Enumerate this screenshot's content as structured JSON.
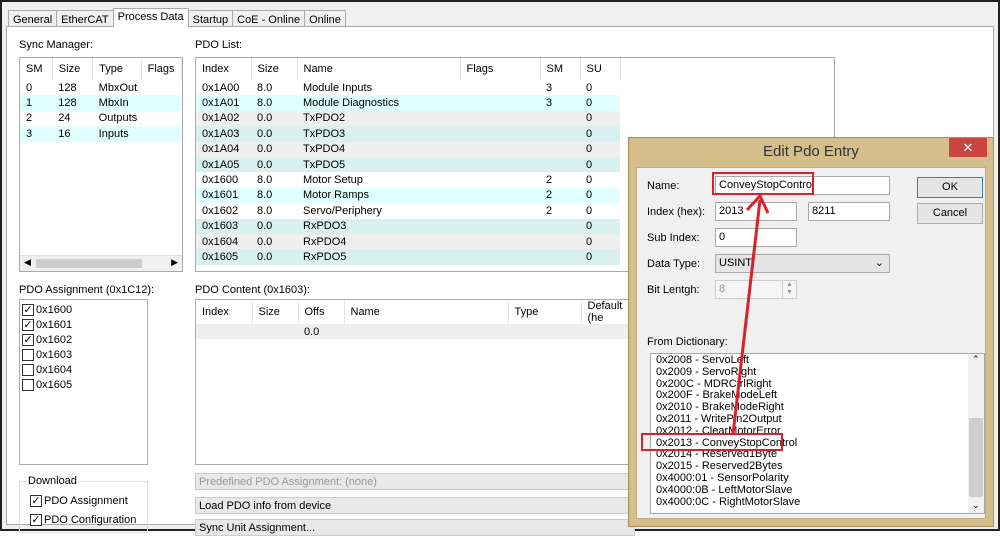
{
  "tabs": [
    "General",
    "EtherCAT",
    "Process Data",
    "Startup",
    "CoE - Online",
    "Online"
  ],
  "sync_manager": {
    "label": "Sync Manager:",
    "columns": [
      "SM",
      "Size",
      "Type",
      "Flags"
    ],
    "rows": [
      [
        "0",
        "128",
        "MbxOut",
        ""
      ],
      [
        "1",
        "128",
        "MbxIn",
        ""
      ],
      [
        "2",
        "24",
        "Outputs",
        ""
      ],
      [
        "3",
        "16",
        "Inputs",
        ""
      ]
    ]
  },
  "pdo_list": {
    "label": "PDO List:",
    "columns": [
      "Index",
      "Size",
      "Name",
      "Flags",
      "SM",
      "SU"
    ],
    "rows": [
      [
        "0x1A00",
        "8.0",
        "Module Inputs",
        "",
        "3",
        "0"
      ],
      [
        "0x1A01",
        "8.0",
        "Module Diagnostics",
        "",
        "3",
        "0"
      ],
      [
        "0x1A02",
        "0.0",
        "TxPDO2",
        "",
        "",
        "0"
      ],
      [
        "0x1A03",
        "0.0",
        "TxPDO3",
        "",
        "",
        "0"
      ],
      [
        "0x1A04",
        "0.0",
        "TxPDO4",
        "",
        "",
        "0"
      ],
      [
        "0x1A05",
        "0.0",
        "TxPDO5",
        "",
        "",
        "0"
      ],
      [
        "0x1600",
        "8.0",
        "Motor Setup",
        "",
        "2",
        "0"
      ],
      [
        "0x1601",
        "8.0",
        "Motor Ramps",
        "",
        "2",
        "0"
      ],
      [
        "0x1602",
        "8.0",
        "Servo/Periphery",
        "",
        "2",
        "0"
      ],
      [
        "0x1603",
        "0.0",
        "RxPDO3",
        "",
        "",
        "0"
      ],
      [
        "0x1604",
        "0.0",
        "RxPDO4",
        "",
        "",
        "0"
      ],
      [
        "0x1605",
        "0.0",
        "RxPDO5",
        "",
        "",
        "0"
      ]
    ]
  },
  "pdo_assignment": {
    "label": "PDO Assignment (0x1C12):",
    "items": [
      {
        "label": "0x1600",
        "checked": true
      },
      {
        "label": "0x1601",
        "checked": true
      },
      {
        "label": "0x1602",
        "checked": true
      },
      {
        "label": "0x1603",
        "checked": false
      },
      {
        "label": "0x1604",
        "checked": false
      },
      {
        "label": "0x1605",
        "checked": false
      }
    ]
  },
  "pdo_content": {
    "label": "PDO Content (0x1603):",
    "columns": [
      "Index",
      "Size",
      "Offs",
      "Name",
      "Type",
      "Default (he"
    ],
    "rows": [
      [
        "",
        "",
        "0.0",
        "",
        "",
        ""
      ]
    ]
  },
  "download": {
    "label": "Download",
    "items": [
      {
        "label": "PDO Assignment",
        "checked": true
      },
      {
        "label": "PDO Configuration",
        "checked": true
      }
    ]
  },
  "buttons": {
    "predefined": "Predefined PDO Assignment: (none)",
    "load": "Load PDO info from device",
    "sync_unit": "Sync Unit Assignment..."
  },
  "dialog": {
    "title": "Edit Pdo Entry",
    "close": "✕",
    "name_label": "Name:",
    "name_value": "ConveyStopControl",
    "index_label": "Index (hex):",
    "index_value": "2013",
    "index_value2": "8211",
    "subindex_label": "Sub Index:",
    "subindex_value": "0",
    "datatype_label": "Data Type:",
    "datatype_value": "USINT",
    "bitlength_label": "Bit Lentgh:",
    "bitlength_value": "8",
    "ok": "OK",
    "cancel": "Cancel",
    "dict_label": "From Dictionary:",
    "dictionary": [
      "0x2008 - ServoLeft",
      "0x2009 - ServoRight",
      "0x200C - MDRCtrlRight",
      "0x200F - BrakeModeLeft",
      "0x2010 - BrakeModeRight",
      "0x2011 - WritePin2Output",
      "0x2012 - ClearMotorError",
      "0x2013 - ConveyStopControl",
      "0x2014 - Reserved1Byte",
      "0x2015 - Reserved2Bytes",
      "0x4000:01 - SensorPolarity",
      "0x4000:0B - LeftMotorSlave",
      "0x4000:0C - RightMotorSlave"
    ],
    "selected_index": 7
  },
  "colors": {
    "highlight": "#d9212c",
    "dialog_frame": "#d4bf8c"
  }
}
